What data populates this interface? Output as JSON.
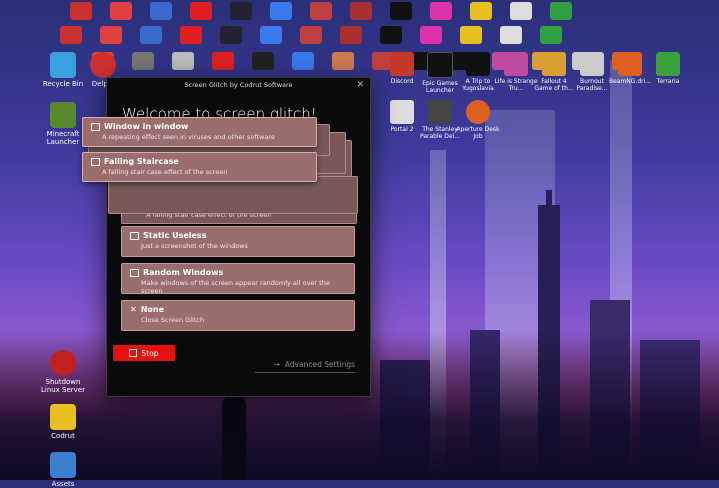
{
  "window": {
    "title": "Screen Glitch by Codrut Software",
    "close_glyph": "✕",
    "welcome": "Welcome to screen glitch!"
  },
  "floating": {
    "window_in_window": {
      "title": "Window in window",
      "desc": "A repeating effect seen in viruses and other software"
    },
    "falling_staircase": {
      "title": "Falling Staircase",
      "desc": "A falling stair case effect of the screen"
    },
    "ghost_staircase": {
      "title": "Falling Staircase",
      "desc": "A falling stair case effect of the screen"
    }
  },
  "options": [
    {
      "title": "Static Useless",
      "desc": "Just a screenshot of the windows",
      "icon": "window-icon"
    },
    {
      "title": "Random Windows",
      "desc": "Make windows of the screen appear randomly all over the screen",
      "icon": "windows-icon"
    },
    {
      "title": "None",
      "desc": "Close Screen Glitch",
      "icon": "close-icon"
    }
  ],
  "buttons": {
    "stop": "Stop",
    "advanced": "Advanced Settings",
    "advanced_glyph": "→"
  },
  "desktop_icons_left": [
    {
      "label": "Recycle Bin"
    },
    {
      "label": "Delphi"
    },
    {
      "label": "Minecraft Launcher"
    },
    {
      "label": "Shutdown Linux Server"
    },
    {
      "label": "Codrut"
    },
    {
      "label": "Assets"
    }
  ],
  "desktop_icons_top": [
    {
      "label": "Discord"
    },
    {
      "label": "Epic Games Launcher"
    },
    {
      "label": "A Trip to Yugoslavia"
    },
    {
      "label": "Life is Strange Tru..."
    },
    {
      "label": "Fallout 4 Game of th..."
    },
    {
      "label": "Burnout Paradise..."
    },
    {
      "label": "BeamNG.dri..."
    },
    {
      "label": "Terraria"
    }
  ],
  "desktop_icons_mid": [
    {
      "label": "Portal 2"
    },
    {
      "label": "The Stanley Parable Del..."
    },
    {
      "label": "Aperture Desk Job"
    }
  ],
  "colors": {
    "stop": "#e51010",
    "option_bg": "#9b6e6e",
    "window_bg": "#0b0b0e"
  }
}
